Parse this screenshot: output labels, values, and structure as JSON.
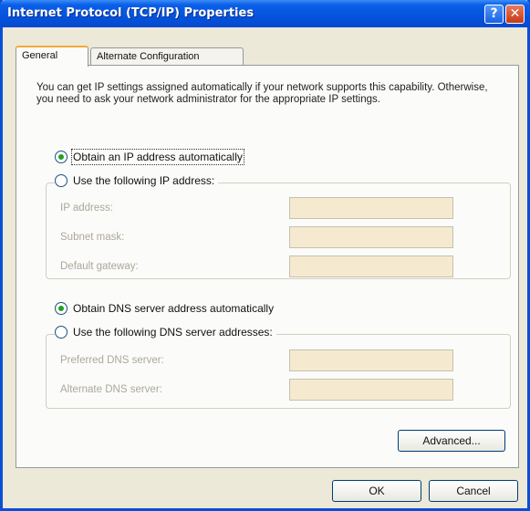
{
  "window": {
    "title": "Internet Protocol (TCP/IP) Properties",
    "help_glyph": "?",
    "close_glyph": "✕"
  },
  "tabs": [
    {
      "label": "General",
      "active": true
    },
    {
      "label": "Alternate Configuration",
      "active": false
    }
  ],
  "description": "You can get IP settings assigned automatically if your network supports this capability. Otherwise, you need to ask your network administrator for the appropriate IP settings.",
  "ip": {
    "auto_label": "Obtain an IP address automatically",
    "manual_label": "Use the following IP address:",
    "auto_selected": true,
    "fields": [
      {
        "label": "IP address:",
        "value": ""
      },
      {
        "label": "Subnet mask:",
        "value": ""
      },
      {
        "label": "Default gateway:",
        "value": ""
      }
    ]
  },
  "dns": {
    "auto_label": "Obtain DNS server address automatically",
    "manual_label": "Use the following DNS server addresses:",
    "auto_selected": true,
    "fields": [
      {
        "label": "Preferred DNS server:",
        "value": ""
      },
      {
        "label": "Alternate DNS server:",
        "value": ""
      }
    ]
  },
  "buttons": {
    "advanced": "Advanced...",
    "ok": "OK",
    "cancel": "Cancel"
  },
  "colors": {
    "title_bar": "#0553dc",
    "dialog_bg": "#ece9d8",
    "disabled_field": "#f5e9cf",
    "radio_dot": "#21a121"
  }
}
